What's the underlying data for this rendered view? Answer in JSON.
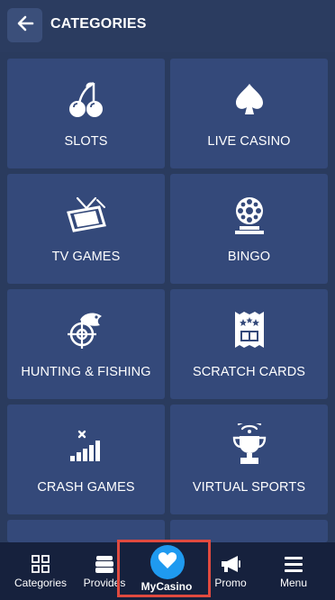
{
  "header": {
    "title": "CATEGORIES",
    "back_icon": "arrow-left-icon"
  },
  "categories": [
    {
      "label": "SLOTS",
      "icon": "cherries-icon"
    },
    {
      "label": "LIVE CASINO",
      "icon": "spade-icon"
    },
    {
      "label": "TV GAMES",
      "icon": "tv-icon"
    },
    {
      "label": "BINGO",
      "icon": "bingo-drum-icon"
    },
    {
      "label": "HUNTING & FISHING",
      "icon": "fish-target-icon"
    },
    {
      "label": "SCRATCH CARDS",
      "icon": "scratch-ticket-icon"
    },
    {
      "label": "CRASH GAMES",
      "icon": "signal-bars-icon"
    },
    {
      "label": "VIRTUAL SPORTS",
      "icon": "trophy-icon"
    }
  ],
  "bottom_nav": {
    "items": [
      {
        "label": "Categories",
        "icon": "grid-icon"
      },
      {
        "label": "Provides",
        "icon": "cards-stack-icon"
      },
      {
        "label": "MyCasino",
        "icon": "heart-icon"
      },
      {
        "label": "Promo",
        "icon": "megaphone-icon"
      },
      {
        "label": "Menu",
        "icon": "hamburger-icon"
      }
    ]
  },
  "colors": {
    "background": "#2a3b5e",
    "tile": "#34497a",
    "bottom_nav": "#16213d",
    "accent": "#1f9af0",
    "highlight": "#e04a3f"
  }
}
